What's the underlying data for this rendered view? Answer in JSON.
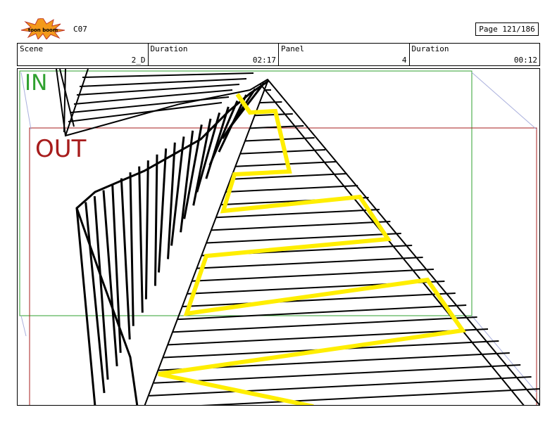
{
  "header": {
    "logo_text": "toon boom",
    "scene_code": "C07",
    "page": "Page 121/186"
  },
  "info": {
    "scene_label": "Scene",
    "scene_value": "2_D",
    "duration1_label": "Duration",
    "duration1_value": "02:17",
    "panel_label": "Panel",
    "panel_value": "4",
    "duration2_label": "Duration",
    "duration2_value": "00:12"
  },
  "panel": {
    "in_label": "IN",
    "out_label": "OUT",
    "colors": {
      "in": "#2fa12f",
      "out": "#a71c1c",
      "path": "#ffee00"
    }
  }
}
